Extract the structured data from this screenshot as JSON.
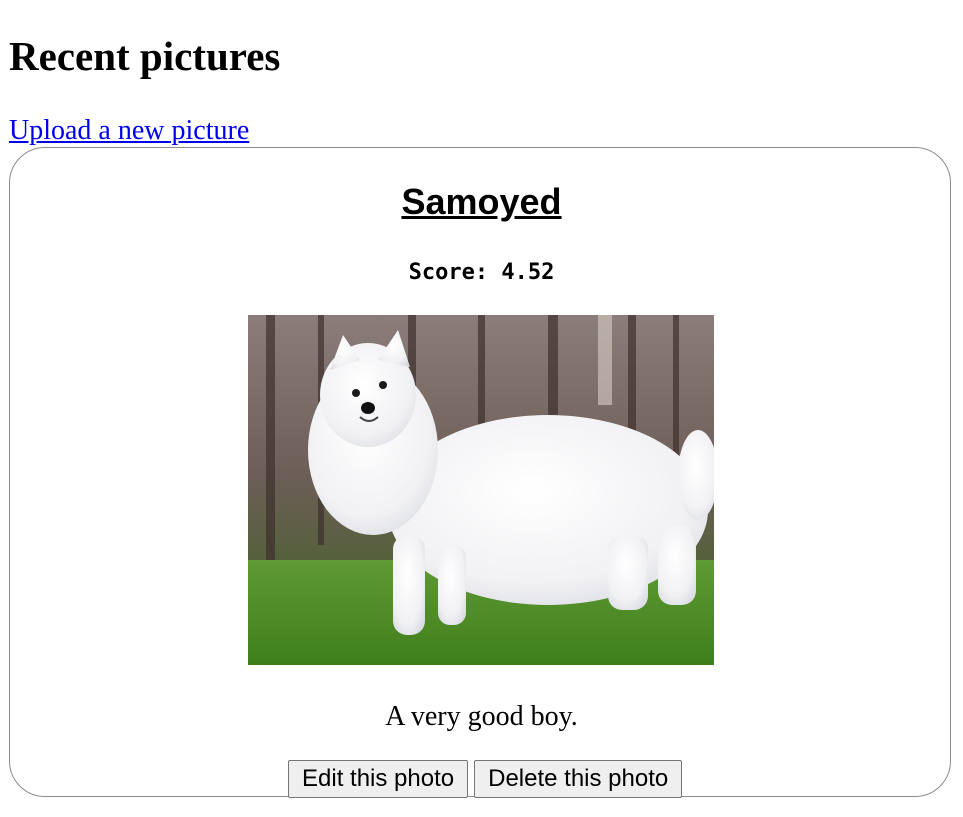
{
  "page": {
    "title": "Recent pictures",
    "upload_link": "Upload a new picture"
  },
  "post": {
    "title": "Samoyed",
    "score_text": "Score: 4.52",
    "image_alt": "White fluffy Samoyed dog standing on green grass",
    "description": "A very good boy.",
    "edit_label": "Edit this photo",
    "delete_label": "Delete this photo"
  },
  "colors": {
    "link": "#0000ee",
    "card_border": "#8c8c8c",
    "button_bg": "#efefef",
    "button_border": "#767676"
  }
}
